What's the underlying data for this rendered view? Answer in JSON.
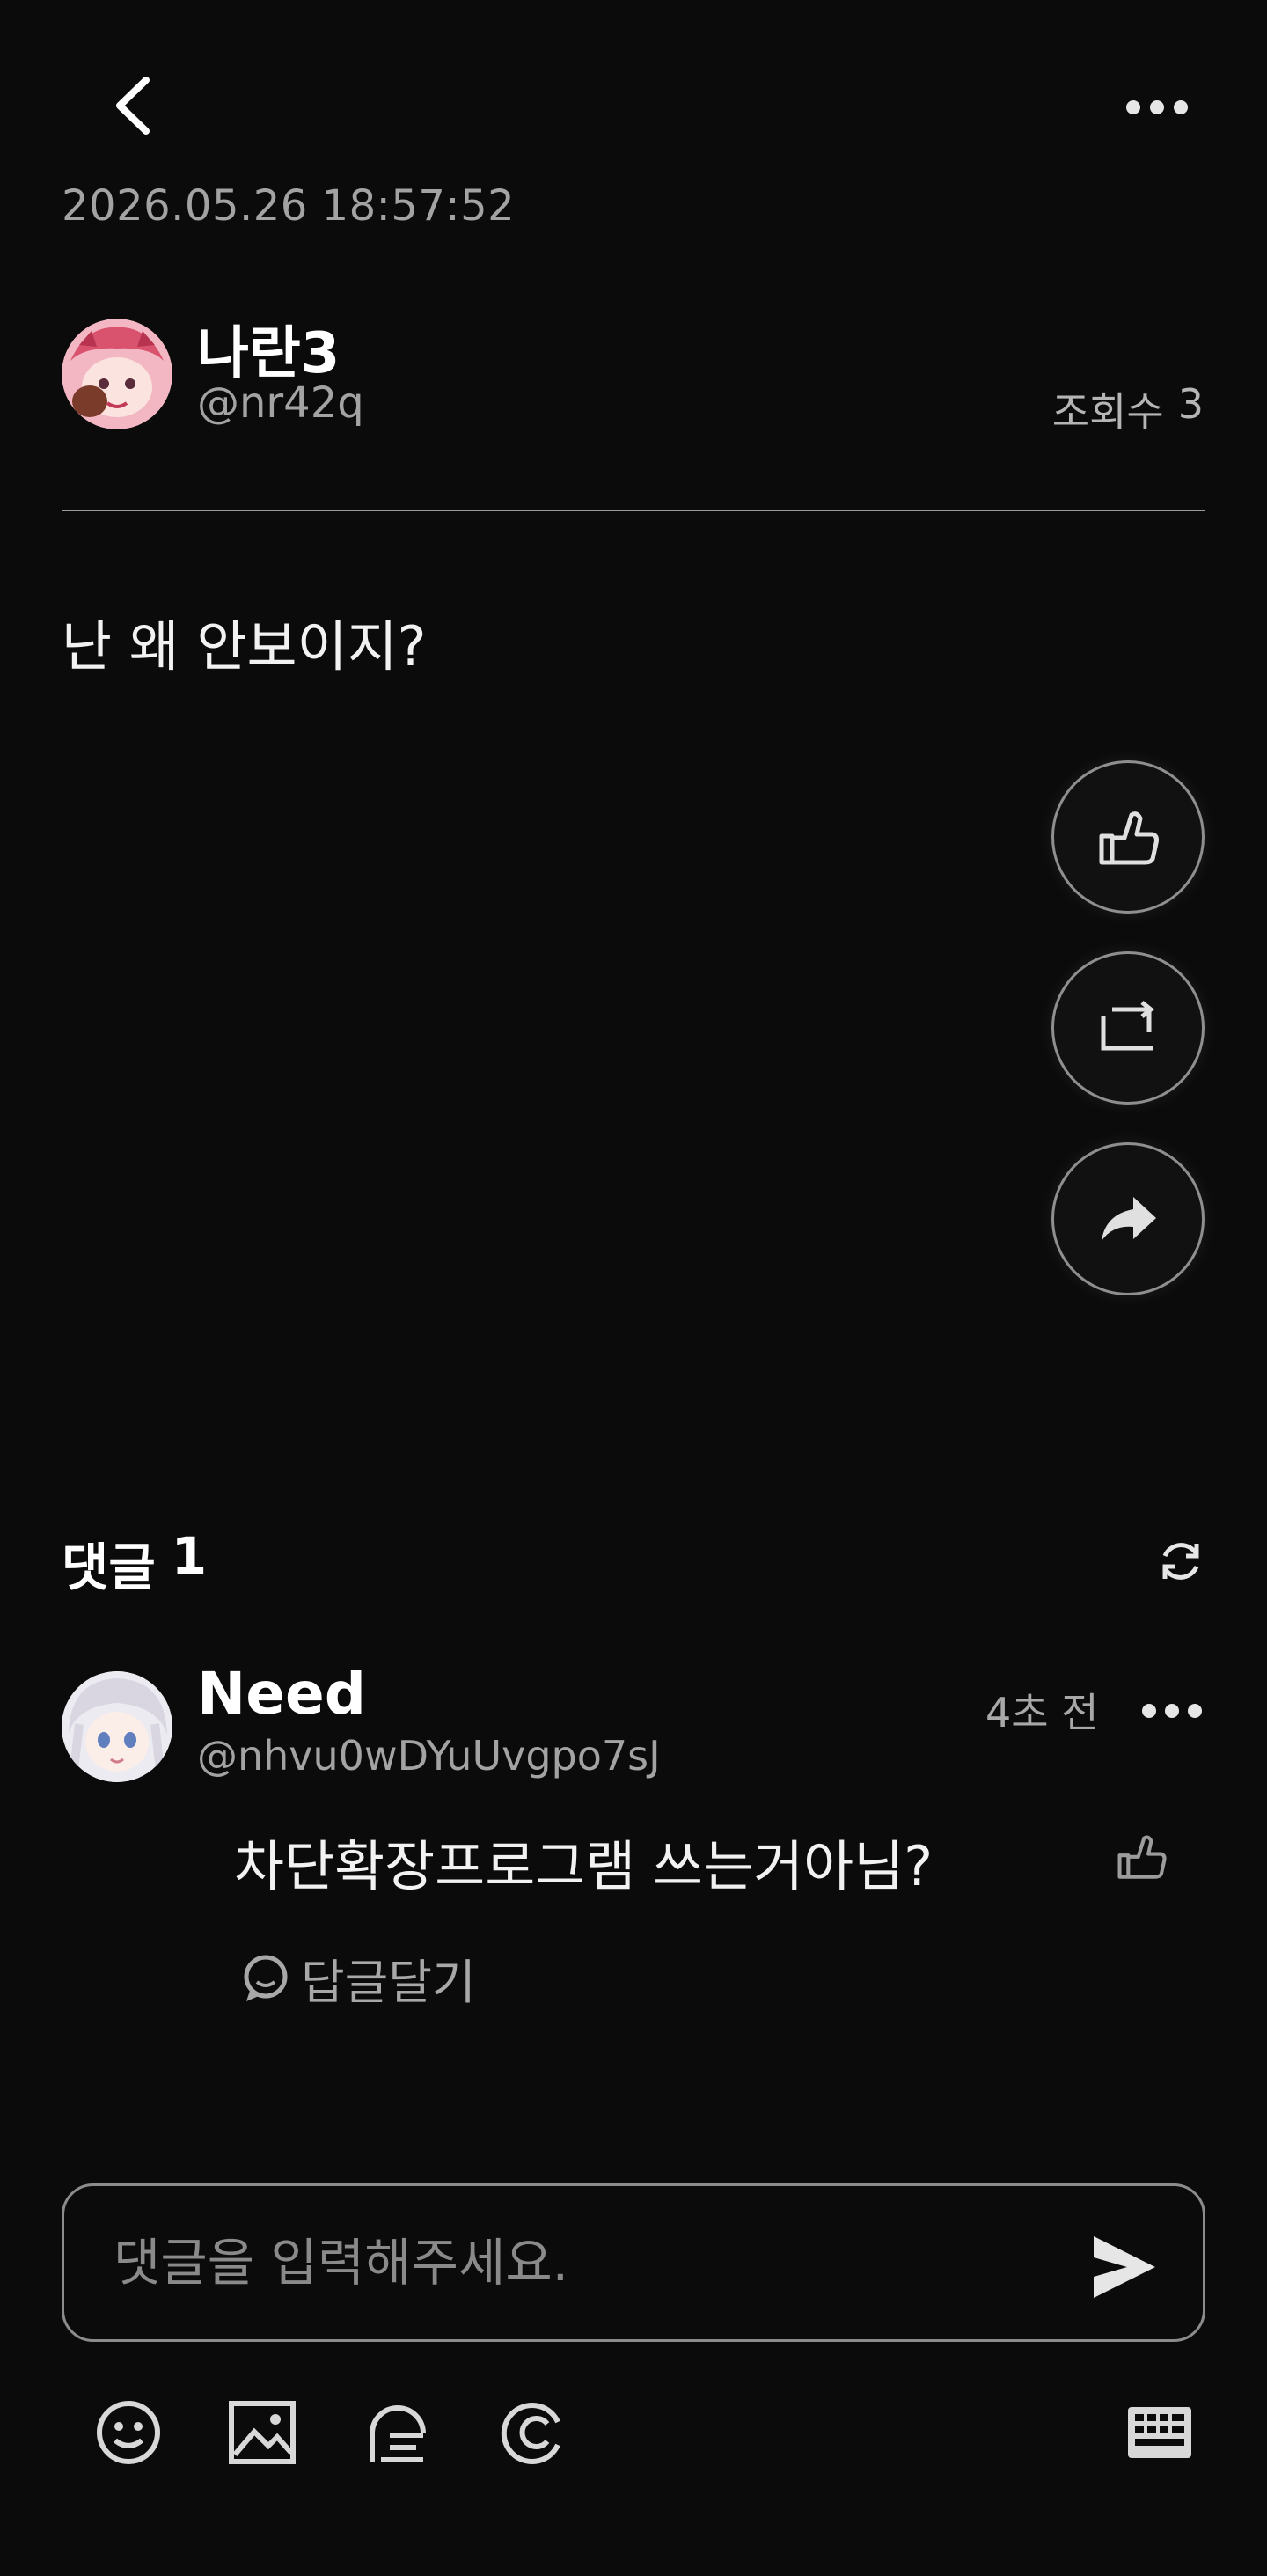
{
  "header": {
    "back_icon": "chevron-left-icon",
    "more_icon": "ellipsis-icon"
  },
  "post": {
    "timestamp": "2026.05.26 18:57:52",
    "author": {
      "name": "나란3",
      "handle": "@nr42q",
      "avatar_icon": "user-avatar-pink-character"
    },
    "views_label": "조회수",
    "views_count": "3",
    "body": "난 왜 안보이지?"
  },
  "actions": {
    "like_icon": "thumbs-up-icon",
    "repost_icon": "repost-icon",
    "share_icon": "share-arrow-icon"
  },
  "comments": {
    "header_label": "댓글",
    "count": "1",
    "refresh_icon": "refresh-icon",
    "items": [
      {
        "author": "Need",
        "handle": "@nhvu0wDYuUvgpo7sJ",
        "time": "4초 전",
        "text": "차단확장프로그램 쓰는거아님?",
        "reply_label": "답글달기"
      }
    ]
  },
  "composer": {
    "placeholder": "댓글을 입력해주세요.",
    "send_icon": "send-icon"
  },
  "toolbar": {
    "items": [
      "emoji-icon",
      "image-icon",
      "poll-icon",
      "mention-icon",
      "keyboard-icon"
    ]
  },
  "colors": {
    "background": "#0b0b0c",
    "primary_text": "#ffffff",
    "secondary_text": "#a3a3a3",
    "border": "#8f8f8f"
  }
}
